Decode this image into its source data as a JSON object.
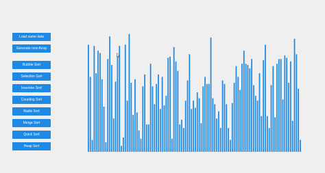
{
  "controls": {
    "load_same_data": "Load same data",
    "generate_new_array": "Generate new Array",
    "algorithms": [
      "Bubble Sort",
      "Selection Sort",
      "Insertion Sort",
      "Counting Sort",
      "Radix Sort",
      "Merge Sort",
      "Quick Sort",
      "Heap Sort"
    ]
  },
  "array": {
    "bar_color": "#1e88e5",
    "values": [
      90,
      63,
      10,
      89,
      66,
      85,
      83,
      61,
      38,
      8,
      78,
      97,
      73,
      28,
      59,
      80,
      89,
      5,
      12,
      90,
      43,
      99,
      58,
      31,
      61,
      33,
      18,
      11,
      55,
      65,
      23,
      23,
      74,
      55,
      40,
      57,
      65,
      36,
      63,
      39,
      47,
      79,
      80,
      11,
      88,
      76,
      68,
      23,
      27,
      20,
      43,
      60,
      82,
      36,
      43,
      37,
      50,
      45,
      24,
      55,
      63,
      57,
      57,
      96,
      45,
      40,
      28,
      34,
      20,
      60,
      57,
      40,
      20,
      10,
      41,
      58,
      72,
      63,
      52,
      74,
      85,
      74,
      73,
      70,
      78,
      56,
      47,
      43,
      66,
      30,
      77,
      90,
      30,
      20,
      56,
      72,
      29,
      74,
      78,
      78,
      44,
      81,
      79,
      58,
      76,
      26,
      95,
      82,
      53,
      10
    ]
  }
}
